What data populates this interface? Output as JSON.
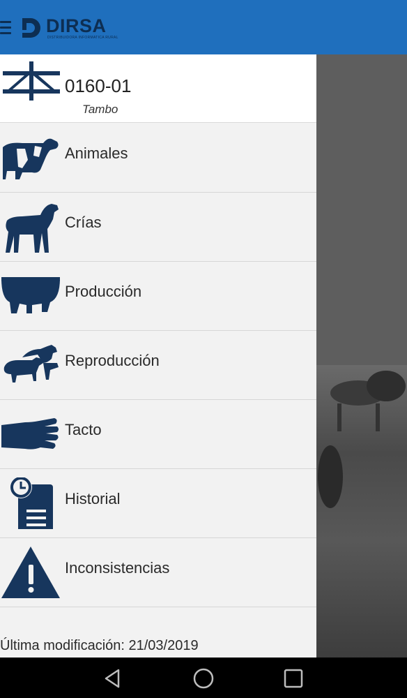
{
  "appbar": {
    "brand": "DIRSA",
    "brand_sub": "DISTRIBUIDORA INFORMATICA RURAL",
    "menu_icon": "hamburger-icon"
  },
  "header": {
    "code": "0160-01",
    "subtitle": "Tambo",
    "icon": "establishment-logo-icon"
  },
  "menu": [
    {
      "label": "Animales",
      "icon": "cow-icon"
    },
    {
      "label": "Crías",
      "icon": "calf-icon"
    },
    {
      "label": "Producción",
      "icon": "udder-icon"
    },
    {
      "label": "Reproducción",
      "icon": "breeding-icon"
    },
    {
      "label": "Tacto",
      "icon": "glove-icon"
    },
    {
      "label": "Historial",
      "icon": "history-icon"
    },
    {
      "label": "Inconsistencias",
      "icon": "warning-icon"
    }
  ],
  "footer": {
    "last_modified": "Última modificación: 21/03/2019"
  },
  "navbar": {
    "back": "back-icon",
    "home": "home-icon",
    "recents": "recents-icon"
  },
  "colors": {
    "appbar": "#1f6fbd",
    "icon": "#17365d",
    "drawer": "#f2f2f2"
  }
}
